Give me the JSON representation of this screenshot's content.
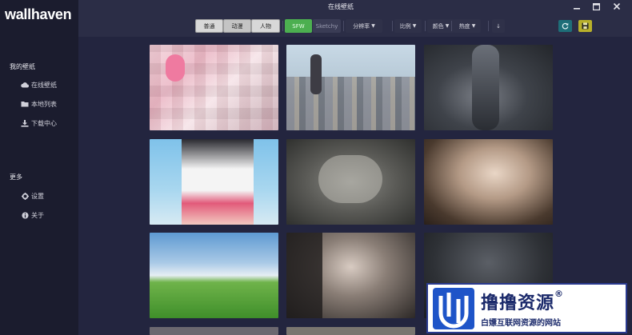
{
  "app": {
    "logo": "wallhaven",
    "window_title": "在线壁纸"
  },
  "sidebar": {
    "section1_title": "我的壁纸",
    "items": [
      {
        "label": "在线壁纸",
        "icon": "cloud-icon"
      },
      {
        "label": "本地列表",
        "icon": "folder-icon"
      },
      {
        "label": "下载中心",
        "icon": "download-icon"
      }
    ],
    "section2_title": "更多",
    "more_items": [
      {
        "label": "设置",
        "icon": "gear-icon"
      },
      {
        "label": "关于",
        "icon": "info-icon"
      }
    ]
  },
  "toolbar": {
    "category_tabs": [
      "普通",
      "动漫",
      "人物"
    ],
    "purity": {
      "sfw": "SFW",
      "sketchy": "Sketchy"
    },
    "dropdowns": [
      "分辨率",
      "比例",
      "颜色",
      "热度"
    ],
    "download_arrow": "↓",
    "refresh_icon": "refresh-icon",
    "save_icon": "save-icon"
  },
  "window_controls": {
    "minimize": "minimize-icon",
    "maximize": "maximize-icon",
    "close": "close-icon"
  },
  "wallpapers": [
    {
      "theme": "pink anime girl (pixelated)"
    },
    {
      "theme": "girl on rooftop cityscape"
    },
    {
      "theme": "dark figure with flowing hair"
    },
    {
      "theme": "anime girl with pink skirt"
    },
    {
      "theme": "crouching figure monochrome"
    },
    {
      "theme": "pale woman portrait"
    },
    {
      "theme": "green hill blue sky"
    },
    {
      "theme": "dark haired woman close-up"
    },
    {
      "theme": "dark armored figure"
    }
  ],
  "watermark": {
    "title": "撸撸资源",
    "reg": "®",
    "subtitle": "白嫖互联网资源的网站"
  },
  "colors": {
    "accent_green": "#4caf50",
    "refresh_bg": "#1e6e78",
    "save_bg": "#b8b02a",
    "sidebar_bg": "#1b1c2e",
    "content_bg": "#23253f"
  }
}
